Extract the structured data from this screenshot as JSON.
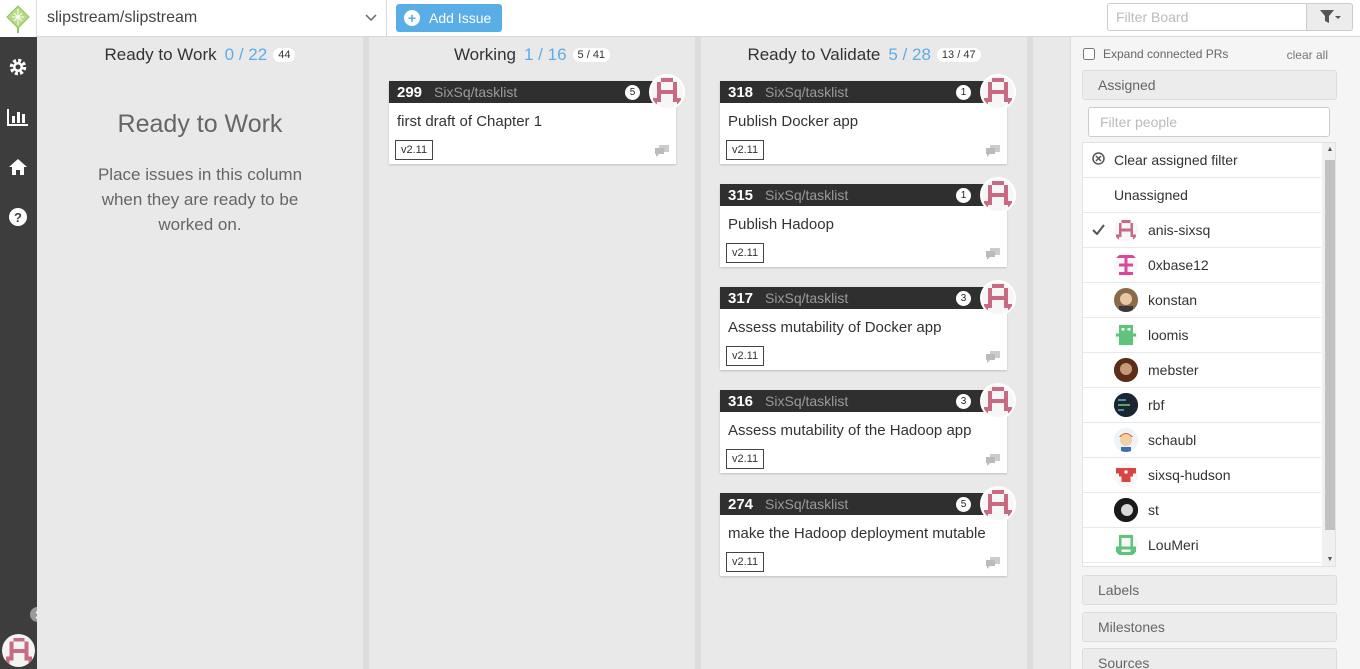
{
  "topbar": {
    "repo": "slipstream/slipstream",
    "add_issue": "Add Issue",
    "filter_board_placeholder": "Filter Board"
  },
  "colors": {
    "accent": "#5aaee8",
    "card_header": "#2f2f2f",
    "rail": "#3d3d3d"
  },
  "rail": {
    "icons": [
      "gear-icon",
      "chart-icon",
      "home-icon",
      "help-icon"
    ]
  },
  "columns": [
    {
      "title": "Ready to Work",
      "count": "0 / 22",
      "badge": "44",
      "empty_title": "Ready to Work",
      "empty_text": "Place issues in this column when they are ready to be worked on."
    },
    {
      "title": "Working",
      "count": "1 / 16",
      "badge": "5 / 41",
      "cards": [
        {
          "number": "299",
          "repo": "SixSq/tasklist",
          "comments": "5",
          "title": "first draft of Chapter 1",
          "label": "v2.11"
        }
      ]
    },
    {
      "title": "Ready to Validate",
      "count": "5 / 28",
      "badge": "13 / 47",
      "cards": [
        {
          "number": "318",
          "repo": "SixSq/tasklist",
          "comments": "1",
          "title": "Publish Docker app",
          "label": "v2.11"
        },
        {
          "number": "315",
          "repo": "SixSq/tasklist",
          "comments": "1",
          "title": "Publish Hadoop",
          "label": "v2.11"
        },
        {
          "number": "317",
          "repo": "SixSq/tasklist",
          "comments": "3",
          "title": "Assess mutability of Docker app",
          "label": "v2.11"
        },
        {
          "number": "316",
          "repo": "SixSq/tasklist",
          "comments": "3",
          "title": "Assess mutability of the Hadoop app",
          "label": "v2.11"
        },
        {
          "number": "274",
          "repo": "SixSq/tasklist",
          "comments": "5",
          "title": "make the Hadoop deployment mutable",
          "label": "v2.11"
        }
      ]
    }
  ],
  "panel": {
    "expand_prs": "Expand connected PRs",
    "clear_all": "clear all",
    "assigned": "Assigned",
    "filter_people_placeholder": "Filter people",
    "clear_assigned": "Clear assigned filter",
    "unassigned": "Unassigned",
    "people": [
      {
        "name": "anis-sixsq",
        "checked": true
      },
      {
        "name": "0xbase12",
        "checked": false
      },
      {
        "name": "konstan",
        "checked": false
      },
      {
        "name": "loomis",
        "checked": false
      },
      {
        "name": "mebster",
        "checked": false
      },
      {
        "name": "rbf",
        "checked": false
      },
      {
        "name": "schaubl",
        "checked": false
      },
      {
        "name": "sixsq-hudson",
        "checked": false
      },
      {
        "name": "st",
        "checked": false
      },
      {
        "name": "LouMeri",
        "checked": false
      }
    ],
    "labels": "Labels",
    "milestones": "Milestones",
    "sources": "Sources"
  }
}
